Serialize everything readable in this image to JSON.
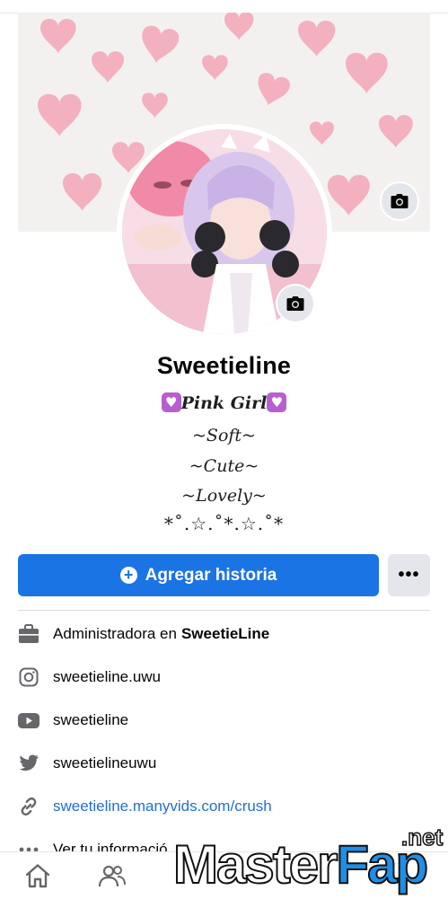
{
  "profile": {
    "name": "Sweetieline",
    "bio": {
      "line1": "Pink Girl",
      "line2": "~Soft~",
      "line3": "~Cute~",
      "line4": "~Lovely~",
      "line5": "*˚.☆.˚*.☆.˚*"
    }
  },
  "actions": {
    "add_story_label": "Agregar historia",
    "more_label": "•••"
  },
  "details": {
    "work_prefix": "Administradora en",
    "work_place": "SweetieLine",
    "instagram": "sweetieline.uwu",
    "youtube": "sweetieline",
    "twitter": "sweetielineuwu",
    "website": "sweetieline.manyvids.com/crush",
    "see_more": "Ver tu informació"
  },
  "watermark": {
    "part1": "Master",
    "part2": "Fap",
    "suffix": ".net"
  },
  "colors": {
    "primary": "#1b74e4",
    "link": "#216fdb",
    "heart_pink": "#f4a6b8",
    "icon_gray": "#65676b"
  },
  "icons": [
    "camera-icon",
    "plus-circle-icon",
    "briefcase-icon",
    "instagram-icon",
    "youtube-icon",
    "twitter-icon",
    "link-icon",
    "home-icon",
    "friends-icon"
  ]
}
